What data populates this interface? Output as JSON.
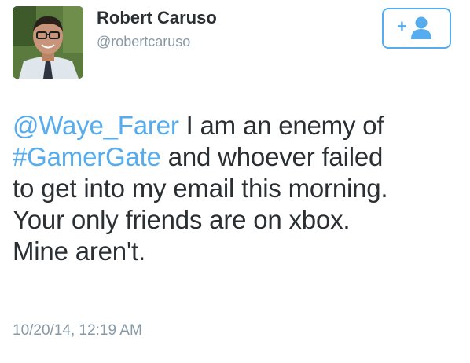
{
  "user": {
    "display_name": "Robert Caruso",
    "username": "@robertcaruso",
    "avatar_icon": "person-photo"
  },
  "follow_button": {
    "icon": "follow-person-plus-icon",
    "plus_glyph": "+"
  },
  "tweet": {
    "mention": "@Waye_Farer",
    "line1_text": " I am an enemy of",
    "hashtag": "#GamerGate",
    "line2_text": " and whoever failed",
    "line3": "to get into my email this morning.",
    "line4": "Your only friends are on xbox.",
    "line5": "Mine aren't."
  },
  "timestamp": "10/20/14, 12:19 AM",
  "colors": {
    "link": "#55acee",
    "text": "#292f33",
    "muted": "#8899a6"
  }
}
